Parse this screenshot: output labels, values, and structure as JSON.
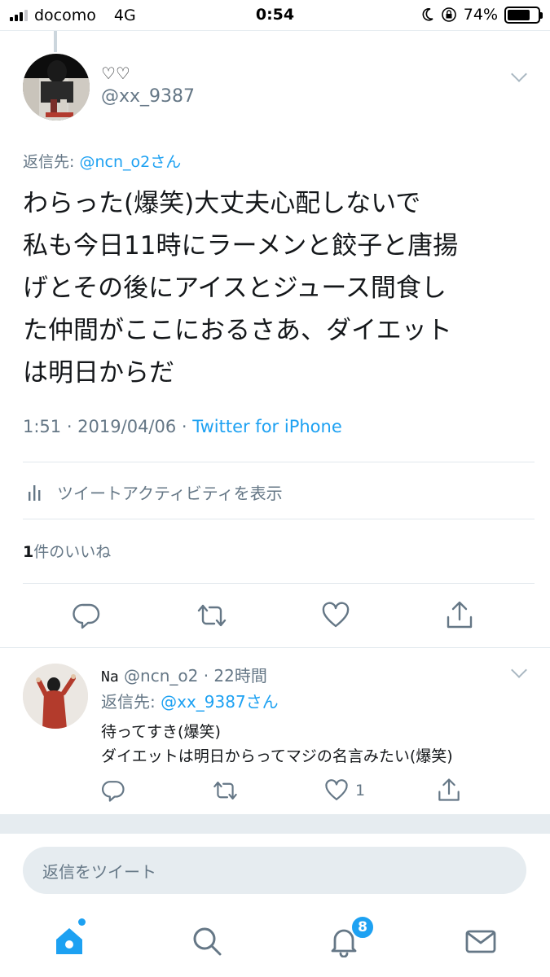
{
  "status_bar": {
    "carrier": "docomo",
    "network": "4G",
    "time": "0:54",
    "battery_percent": "74%",
    "battery_level": 0.74,
    "signal_bars_active": 3
  },
  "main_tweet": {
    "display_name": "♡♡",
    "handle": "@xx_9387",
    "reply_to_prefix": "返信先: ",
    "reply_to_user": "@ncn_o2さん",
    "body_lines": [
      "わらった(爆笑)大丈夫心配しないで",
      "私も今日11時にラーメンと餃子と唐揚",
      "げとその後にアイスとジュース間食し",
      "た仲間がここにおるさあ、ダイエット",
      "は明日からだ"
    ],
    "timestamp": "1:51 · 2019/04/06 · ",
    "client": "Twitter for iPhone",
    "activity_label": "ツイートアクティビティを表示",
    "likes_count": "1",
    "likes_suffix": "件のいいね"
  },
  "reply_tweet": {
    "display_name": "Na",
    "handle_time": " @ncn_o2 · 22時間",
    "reply_to_prefix": "返信先: ",
    "reply_to_user": "@xx_9387さん",
    "body_lines": [
      "待ってすき(爆笑)",
      "ダイエットは明日からってマジの名言みたい(爆笑)"
    ],
    "like_count": "1"
  },
  "composer": {
    "placeholder": "返信をツイート"
  },
  "tab_bar": {
    "notifications_badge": "8"
  },
  "colors": {
    "accent": "#1da1f2",
    "secondary_text": "#657786",
    "divider": "#e1e8ed",
    "band": "#e6ecf0"
  },
  "icons": {
    "reply": "reply-icon",
    "retweet": "retweet-icon",
    "like": "heart-icon",
    "share": "share-icon",
    "activity": "bar-chart-icon",
    "home": "home-icon",
    "search": "search-icon",
    "notifications": "bell-icon",
    "messages": "envelope-icon"
  }
}
